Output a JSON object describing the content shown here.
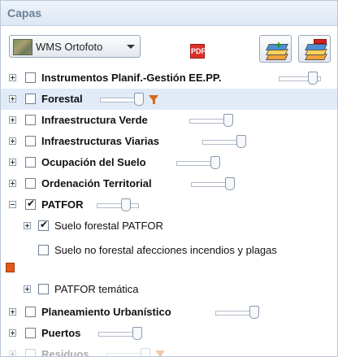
{
  "panel": {
    "title": "Capas"
  },
  "toolbar": {
    "basemap_label": "WMS Ortofoto",
    "icons": [
      "basemap-thumbnail-icon",
      "chevron-down-icon",
      "pdf-icon",
      "add-layer-icon",
      "remove-layer-icon"
    ]
  },
  "layers": [
    {
      "label": "Instrumentos Planif.-Gestión EE.PP.",
      "bold": true,
      "checked": false,
      "expanded": false,
      "opacity": 0.9
    },
    {
      "label": "Forestal",
      "bold": true,
      "checked": false,
      "expanded": false,
      "selected": true,
      "opacity": 0.9,
      "filter": true
    },
    {
      "label": "Infraestructura Verde",
      "bold": true,
      "checked": false,
      "expanded": false,
      "opacity": 0.9
    },
    {
      "label": "Infraestructuras Viarias",
      "bold": true,
      "checked": false,
      "expanded": false,
      "opacity": 0.9
    },
    {
      "label": "Ocupación del Suelo",
      "bold": true,
      "checked": false,
      "expanded": false,
      "opacity": 0.9
    },
    {
      "label": "Ordenación Territorial",
      "bold": true,
      "checked": false,
      "expanded": false,
      "opacity": 0.9
    },
    {
      "label": "PATFOR",
      "bold": true,
      "checked": true,
      "expanded": true,
      "opacity": 0.9,
      "children": [
        {
          "label": "Suelo forestal PATFOR",
          "checked": true,
          "expander": true
        },
        {
          "label": "Suelo no forestal afecciones incendios y plagas",
          "checked": false,
          "expander": false
        },
        {
          "label": "PATFOR temática",
          "checked": false,
          "expander": true
        }
      ]
    },
    {
      "label": "Planeamiento Urbanístico",
      "bold": true,
      "checked": false,
      "expanded": false,
      "opacity": 0.9
    },
    {
      "label": "Puertos",
      "bold": true,
      "checked": false,
      "expanded": false,
      "opacity": 0.9
    },
    {
      "label": "Residuos",
      "bold": true,
      "checked": false,
      "expanded": false,
      "opacity": 0.9,
      "filter": true
    }
  ],
  "colors": {
    "header_bg": "#dde7f3",
    "selected_row": "#e1ebf8",
    "filter_icon": "#d46a1a",
    "pdf_icon": "#d9322b"
  }
}
